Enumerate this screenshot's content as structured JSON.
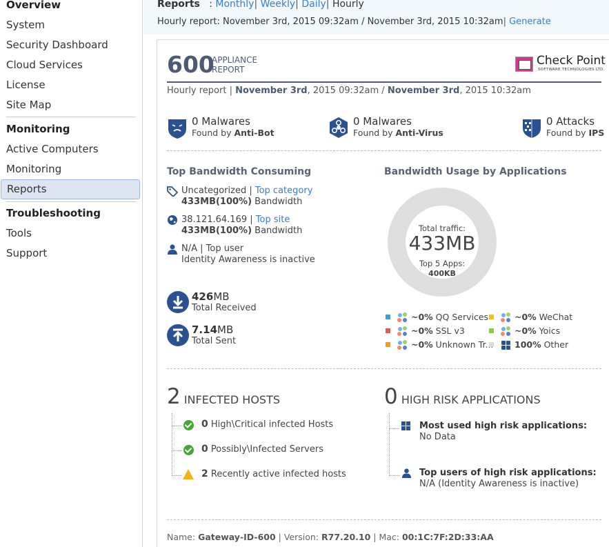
{
  "sidebar": {
    "items": [
      {
        "label": "Overview",
        "type": "head"
      },
      {
        "label": "System"
      },
      {
        "label": "Security Dashboard"
      },
      {
        "label": "Cloud Services"
      },
      {
        "label": "License"
      },
      {
        "label": "Site Map"
      },
      {
        "label": "Monitoring",
        "type": "head"
      },
      {
        "label": "Active Computers"
      },
      {
        "label": "Monitoring"
      },
      {
        "label": "Reports",
        "active": true
      },
      {
        "label": "Troubleshooting",
        "type": "head"
      },
      {
        "label": "Tools"
      },
      {
        "label": "Support"
      }
    ]
  },
  "topbar": {
    "title": "Reports",
    "colon": ":",
    "monthly": "Monthly",
    "weekly": "Weekly",
    "daily": "Daily",
    "hourly": "Hourly",
    "sep": "|",
    "report_line": "Hourly report: November 3rd, 2015 09:32am / November 3rd, 2015 10:32am",
    "generate": "Generate"
  },
  "report": {
    "model": "600",
    "appliance_line1": "APPLIANCE",
    "appliance_line2": "REPORT",
    "brand_name": "Check Point",
    "brand_sub": "SOFTWARE TECHNOLOGIES LTD.",
    "period_prefix": "Hourly report | ",
    "period_start_bold": "November 3rd",
    "period_start_rest": ", 2015 09:32am / ",
    "period_end_bold": "November 3rd",
    "period_end_rest": ", 2015 10:32am",
    "stats": [
      {
        "value": "0 Malwares",
        "found_prefix": "Found by ",
        "found_by": "Anti-Bot",
        "icon": "anti-bot-icon"
      },
      {
        "value": "0 Malwares",
        "found_prefix": "Found by ",
        "found_by": "Anti-Virus",
        "icon": "anti-virus-icon"
      },
      {
        "value": "0 Attacks",
        "found_prefix": "Found by ",
        "found_by": "IPS",
        "icon": "ips-icon"
      }
    ],
    "bandwidth": {
      "title": "Top Bandwidth Consuming",
      "category_name": "Uncategorized",
      "category_link": "Top category",
      "category_value": "433MB(100%)",
      "category_unit": " Bandwidth",
      "site_name": "38.121.64.169",
      "site_link": "Top site",
      "site_value": "433MB(100%)",
      "site_unit": " Bandwidth",
      "user_name": "N/A",
      "user_label": "Top user",
      "user_note": "Identity Awareness is inactive",
      "separator": " | "
    },
    "traffic": {
      "received_num": "426",
      "received_unit": "MB",
      "received_label": "Total Received",
      "sent_num": "7.14",
      "sent_unit": "MB",
      "sent_label": "Total Sent"
    },
    "apps": {
      "title": "Bandwidth Usage by Applications",
      "total_label": "Total traffic:",
      "total_value": "433MB",
      "top5_label": "Top 5 Apps:",
      "top5_value": "400KB",
      "legend": [
        {
          "pct": "~0%",
          "name": "QQ Services",
          "color": "#3aa0d8"
        },
        {
          "pct": "~0%",
          "name": "WeChat",
          "color": "#f2c513"
        },
        {
          "pct": "~0%",
          "name": "SSL v3",
          "color": "#e05a4f"
        },
        {
          "pct": "~0%",
          "name": "Yoics",
          "color": "#8cc84b"
        },
        {
          "pct": "~0%",
          "name": "Unknown Tr...",
          "color": "#f29a1f"
        },
        {
          "pct": "100%",
          "name": "Other",
          "color": "#dddddd"
        }
      ]
    },
    "infected": {
      "count": "2",
      "title": "INFECTED HOSTS",
      "items": [
        {
          "num": "0",
          "text": "High\\Critical infected Hosts",
          "status": "ok"
        },
        {
          "num": "0",
          "text": "Possibly\\Infected Servers",
          "status": "ok"
        },
        {
          "num": "2",
          "text": "Recently active infected hosts",
          "status": "warn"
        }
      ]
    },
    "risk": {
      "count": "0",
      "title": "HIGH RISK APPLICATIONS",
      "most_used_title": "Most used high risk applications:",
      "most_used_value": "No Data",
      "top_users_title": "Top users of high risk applications:",
      "top_users_value": "N/A (Identity Awareness is inactive)"
    },
    "footer": {
      "name_label": "Name: ",
      "name_value": "Gateway-ID-600",
      "version_label": " | Version: ",
      "version_value": "R77.20.10",
      "mac_label": " | Mac: ",
      "mac_value": "00:1C:7F:2D:33:AA"
    }
  },
  "colors": {
    "accent": "#3a7ec8",
    "navy": "#2a5291",
    "title_gray": "#4e5a74"
  }
}
